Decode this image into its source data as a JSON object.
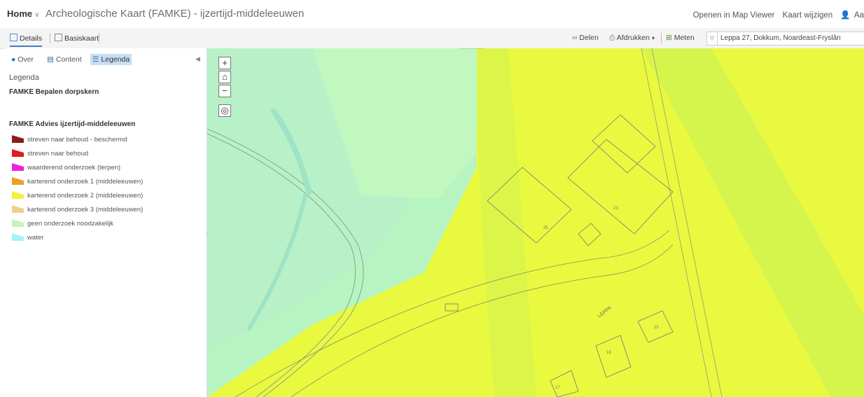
{
  "header": {
    "home_label": "Home",
    "home_chevron": "∨",
    "title": "Archeologische Kaart (FAMKE) - ijzertijd-middeleeuwen",
    "open_map_viewer": "Openen in Map Viewer",
    "change_map": "Kaart wijzigen",
    "user_icon_glyph": "👤",
    "user_initials": "Aa"
  },
  "toolbar": {
    "details": "Details",
    "basemap": "Basiskaart",
    "share": "Delen",
    "print": "Afdrukken",
    "print_caret": "▾",
    "measure": "Meten",
    "search_value": "Leppa 27, Dokkum, Noardeast-Fryslân"
  },
  "panel": {
    "tabs": {
      "about": "Over",
      "content": "Content",
      "legend": "Legenda"
    },
    "title": "Legenda",
    "layer1": "FAMKE Bepalen dorpskern",
    "layer2": "FAMKE Advies ijzertijd-middeleeuwen",
    "legend_items": [
      {
        "label": "streven naar behoud - beschermd",
        "color": "#8b1a1a"
      },
      {
        "label": "streven naar behoud",
        "color": "#e31a1c"
      },
      {
        "label": "waarderend onderzoek (terpen)",
        "color": "#f01ee0"
      },
      {
        "label": "karterend onderzoek 1 (middeleeuwen)",
        "color": "#e8a126"
      },
      {
        "label": "karterend onderzoek 2 (middeleeuwen)",
        "color": "#f2f23a"
      },
      {
        "label": "karterend onderzoek 3 (middeleeuwen)",
        "color": "#f0cf8c"
      },
      {
        "label": "geen onderzoek noodzakelijk",
        "color": "#c2f5b5"
      },
      {
        "label": "water",
        "color": "#a5f3f5"
      }
    ]
  },
  "map": {
    "street_label": "LEPPA",
    "house_numbers": [
      "25",
      "23",
      "15",
      "16",
      "17"
    ],
    "zoom_in": "+",
    "zoom_out": "−",
    "home_glyph": "⌂",
    "locate_glyph": "◎"
  }
}
